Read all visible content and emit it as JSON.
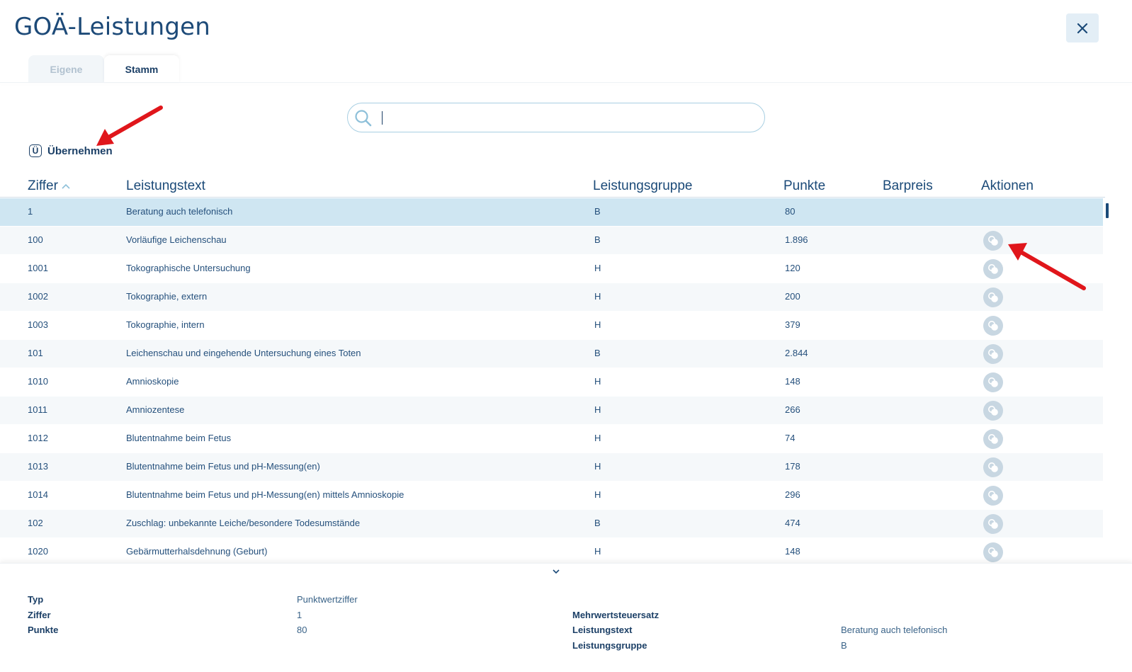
{
  "title": "GOÄ-Leistungen",
  "tabs": [
    {
      "label": "Eigene",
      "active": false
    },
    {
      "label": "Stamm",
      "active": true
    }
  ],
  "search": {
    "value": "",
    "placeholder": ""
  },
  "toolbar": {
    "uebernehmen_label": "Übernehmen",
    "uebernehmen_icon": "Ü"
  },
  "table": {
    "headers": {
      "ziffer": "Ziffer",
      "leistungstext": "Leistungstext",
      "leistungsgruppe": "Leistungsgruppe",
      "punkte": "Punkte",
      "barpreis": "Barpreis",
      "aktionen": "Aktionen"
    },
    "sort": {
      "column": "Ziffer",
      "direction": "ascending"
    },
    "rows": [
      {
        "ziffer": "1",
        "text": "Beratung auch telefonisch",
        "gruppe": "B",
        "punkte": "80",
        "barpreis": "",
        "selected": true,
        "action": false
      },
      {
        "ziffer": "100",
        "text": "Vorläufige Leichenschau",
        "gruppe": "B",
        "punkte": "1.896",
        "barpreis": "",
        "selected": false,
        "action": true
      },
      {
        "ziffer": "1001",
        "text": "Tokographische Untersuchung",
        "gruppe": "H",
        "punkte": "120",
        "barpreis": "",
        "selected": false,
        "action": true
      },
      {
        "ziffer": "1002",
        "text": "Tokographie, extern",
        "gruppe": "H",
        "punkte": "200",
        "barpreis": "",
        "selected": false,
        "action": true
      },
      {
        "ziffer": "1003",
        "text": "Tokographie, intern",
        "gruppe": "H",
        "punkte": "379",
        "barpreis": "",
        "selected": false,
        "action": true
      },
      {
        "ziffer": "101",
        "text": "Leichenschau und eingehende Untersuchung eines Toten",
        "gruppe": "B",
        "punkte": "2.844",
        "barpreis": "",
        "selected": false,
        "action": true
      },
      {
        "ziffer": "1010",
        "text": "Amnioskopie",
        "gruppe": "H",
        "punkte": "148",
        "barpreis": "",
        "selected": false,
        "action": true
      },
      {
        "ziffer": "1011",
        "text": "Amniozentese",
        "gruppe": "H",
        "punkte": "266",
        "barpreis": "",
        "selected": false,
        "action": true
      },
      {
        "ziffer": "1012",
        "text": "Blutentnahme beim Fetus",
        "gruppe": "H",
        "punkte": "74",
        "barpreis": "",
        "selected": false,
        "action": true
      },
      {
        "ziffer": "1013",
        "text": "Blutentnahme beim Fetus und pH-Messung(en)",
        "gruppe": "H",
        "punkte": "178",
        "barpreis": "",
        "selected": false,
        "action": true
      },
      {
        "ziffer": "1014",
        "text": "Blutentnahme beim Fetus und pH-Messung(en) mittels Amnioskopie",
        "gruppe": "H",
        "punkte": "296",
        "barpreis": "",
        "selected": false,
        "action": true
      },
      {
        "ziffer": "102",
        "text": "Zuschlag: unbekannte Leiche/besondere Todesumstände",
        "gruppe": "B",
        "punkte": "474",
        "barpreis": "",
        "selected": false,
        "action": true
      },
      {
        "ziffer": "1020",
        "text": "Gebärmutterhalsdehnung (Geburt)",
        "gruppe": "H",
        "punkte": "148",
        "barpreis": "",
        "selected": false,
        "action": true
      }
    ]
  },
  "details": {
    "left": [
      {
        "label": "Typ",
        "value": "Punktwertziffer"
      },
      {
        "label": "Ziffer",
        "value": "1"
      },
      {
        "label": "Punkte",
        "value": "80"
      }
    ],
    "right": [
      {
        "label": "Mehrwertsteuersatz",
        "value": ""
      },
      {
        "label": "Leistungstext",
        "value": "Beratung auch telefonisch"
      },
      {
        "label": "Leistungsgruppe",
        "value": "B"
      }
    ]
  },
  "icons": {
    "close": "close-icon",
    "search": "search-icon",
    "sort": "chevron-up-icon",
    "action": "copy-icon",
    "collapse": "chevron-down-icon"
  },
  "colors": {
    "primary": "#1b3f66",
    "selected_row": "#cfe6f2",
    "annotation_arrow": "#e0161b"
  }
}
